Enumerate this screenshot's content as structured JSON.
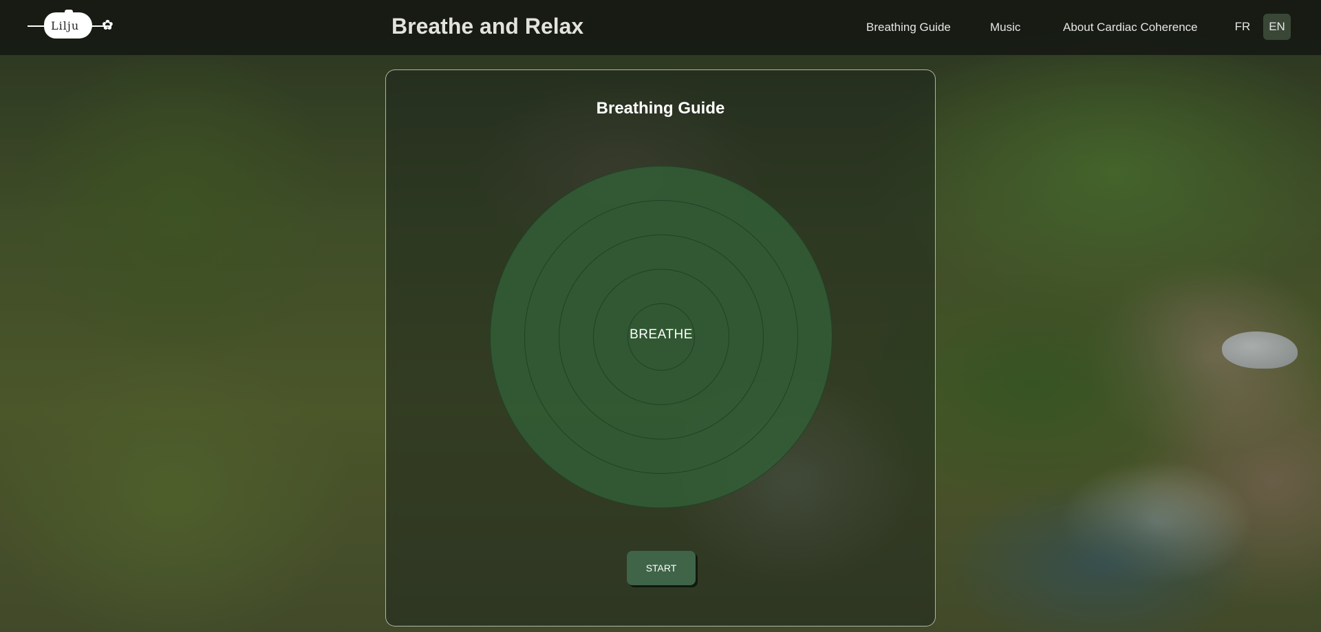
{
  "header": {
    "logo_text": "Lilju",
    "title": "Breathe and Relax",
    "nav": [
      {
        "label": "Breathing Guide"
      },
      {
        "label": "Music"
      },
      {
        "label": "About Cardiac Coherence"
      }
    ],
    "languages": [
      {
        "label": "FR",
        "active": false
      },
      {
        "label": "EN",
        "active": true
      }
    ]
  },
  "guide": {
    "title": "Breathing Guide",
    "instruction": "BREATHE",
    "start_label": "START"
  },
  "colors": {
    "header_bg": "#14180f",
    "circle_fill": "#325f37",
    "button_bg": "#3f6448",
    "active_lang_bg": "#3a4737"
  }
}
